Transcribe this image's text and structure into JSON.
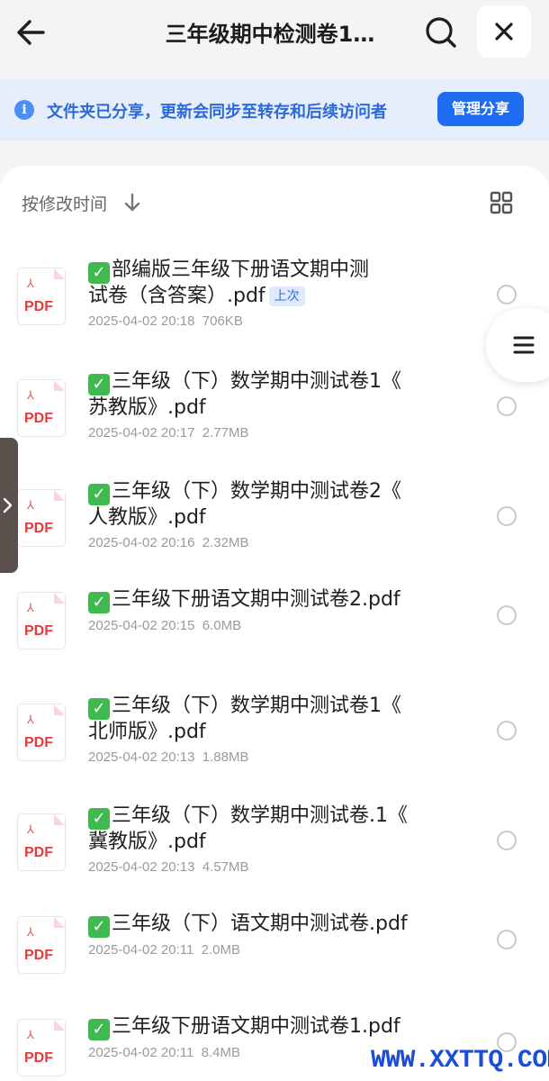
{
  "header": {
    "back_icon": "arrow-left-icon",
    "title": "三年级期中检测卷1…",
    "search_icon": "search-icon",
    "close_icon": "close-icon"
  },
  "notice": {
    "icon": "info-icon",
    "text": "文件夹已分享，更新会同步至转存和后续访问者",
    "button": "管理分享"
  },
  "list": {
    "sort_label": "按修改时间",
    "sort_icon": "arrow-down-icon",
    "view_icon": "grid-view-icon",
    "file_icon_label": "PDF",
    "files": [
      {
        "line1": "部编版三年级下册语文期中测",
        "line2": "试卷（含答案）.pdf",
        "tag": "上次",
        "date": "2025-04-02 20:18",
        "size": "706KB"
      },
      {
        "line1": "三年级（下）数学期中测试卷1《",
        "line2": "苏教版》.pdf",
        "date": "2025-04-02 20:17",
        "size": "2.77MB"
      },
      {
        "line1": "三年级（下）数学期中测试卷2《",
        "line2": "人教版》.pdf",
        "date": "2025-04-02 20:16",
        "size": "2.32MB"
      },
      {
        "line1": "三年级下册语文期中测试卷2.pdf",
        "date": "2025-04-02 20:15",
        "size": "6.0MB"
      },
      {
        "line1": "三年级（下）数学期中测试卷1《",
        "line2": "北师版》.pdf",
        "date": "2025-04-02 20:13",
        "size": "1.88MB"
      },
      {
        "line1": "三年级（下）数学期中测试卷.1《",
        "line2": "冀教版》.pdf",
        "date": "2025-04-02 20:13",
        "size": "4.57MB"
      },
      {
        "line1": "三年级（下）语文期中测试卷.pdf",
        "date": "2025-04-02 20:11",
        "size": "2.0MB"
      },
      {
        "line1": "三年级下册语文期中测试卷1.pdf",
        "date": "2025-04-02 20:11",
        "size": "8.4MB"
      }
    ]
  },
  "floating": {
    "menu_icon": "menu-icon",
    "side_tab_icon": "chevron-right-icon"
  },
  "watermark": "WWW.XXTTQ.COM"
}
